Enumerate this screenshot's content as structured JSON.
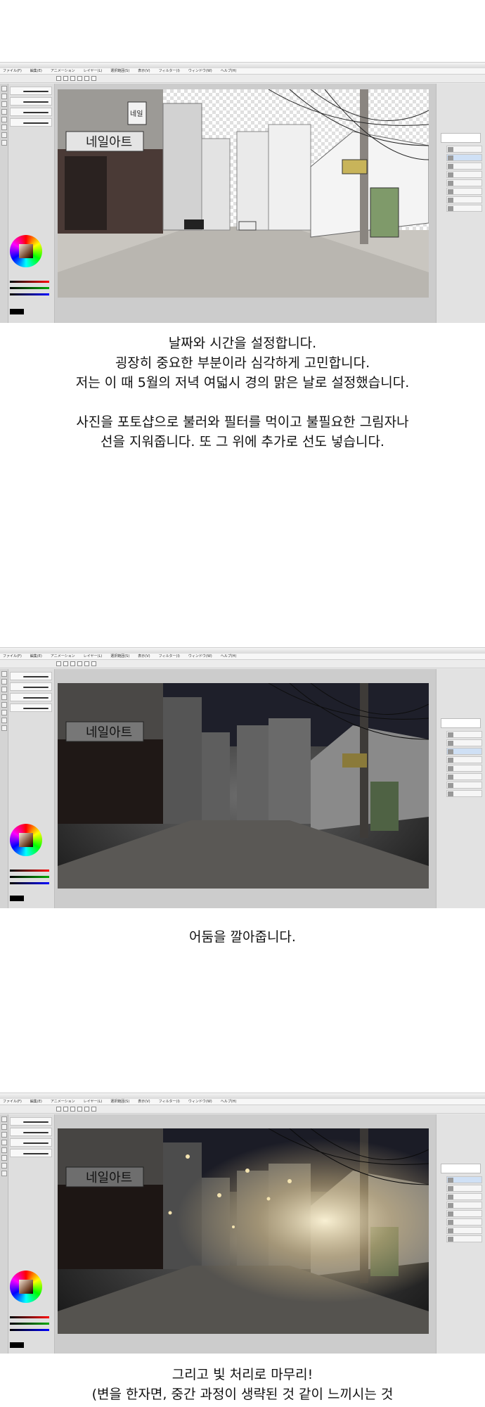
{
  "screens": [
    {
      "title": "ㅤ",
      "menu": [
        "ファイル(F)",
        "編集(E)",
        "アニメーション",
        "レイヤー(L)",
        "選択範囲(S)",
        "表示(V)",
        "フィルター(I)",
        "ウィンドウ(W)",
        "ヘルプ(H)"
      ]
    },
    {
      "title": "ㅤ",
      "menu": [
        "ファイル(F)",
        "編集(E)",
        "アニメーション",
        "レイヤー(L)",
        "選択範囲(S)",
        "表示(V)",
        "フィルター(I)",
        "ウィンドウ(W)",
        "ヘルプ(H)"
      ]
    },
    {
      "title": "ㅤ",
      "menu": [
        "ファイル(F)",
        "編集(E)",
        "アニメーション",
        "レイヤー(L)",
        "選択範囲(S)",
        "表示(V)",
        "フィルター(I)",
        "ウィンドウ(W)",
        "ヘルプ(H)"
      ]
    }
  ],
  "artwork": {
    "sign_main": "네일아트",
    "sign_small": "네일"
  },
  "captions": {
    "c1": [
      "날짜와 시간을 설정합니다.",
      "굉장히 중요한 부분이라 심각하게 고민합니다.",
      "저는 이 때 5월의 저녁 여덟시 경의 맑은 날로 설정했습니다.",
      "",
      "사진을 포토샵으로 불러와 필터를 먹이고 불필요한 그림자나",
      "선을 지워줍니다. 또 그 위에 추가로 선도 넣습니다."
    ],
    "c2": [
      "어둠을 깔아줍니다."
    ],
    "c3": [
      "그리고 빛 처리로 마무리!",
      "(변을 한자면, 중간 과정이 생략된 것 같이 느끼시는 것"
    ]
  },
  "colors": {
    "panel": "#dedede",
    "canvas_bg": "#cccccc"
  }
}
